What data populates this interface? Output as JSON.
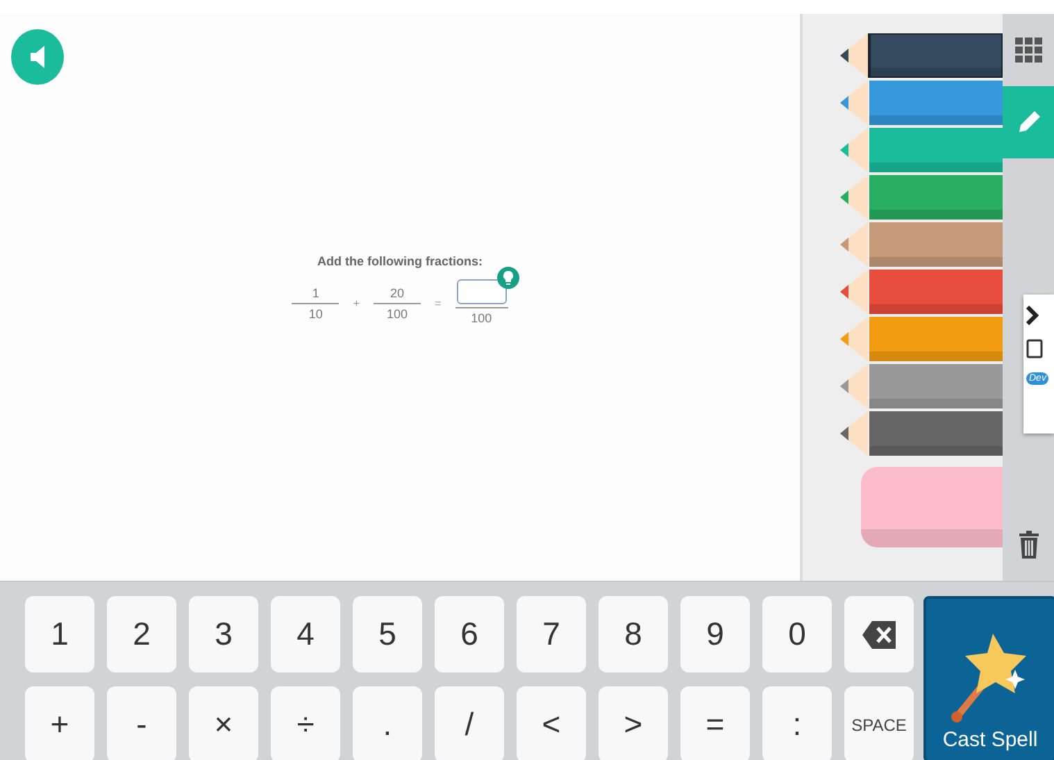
{
  "question": {
    "prompt": "Add the following fractions:",
    "equation": [
      {
        "kind": "fraction",
        "numerator": "1",
        "denominator": "10"
      },
      {
        "kind": "operator",
        "text": "+"
      },
      {
        "kind": "fraction",
        "numerator": "20",
        "denominator": "100"
      },
      {
        "kind": "operator",
        "text": "="
      },
      {
        "kind": "answer",
        "denominator": "100"
      }
    ]
  },
  "pencils": [
    {
      "color": "#34495e",
      "selected": true
    },
    {
      "color": "#3498db",
      "selected": false
    },
    {
      "color": "#1abc9c",
      "selected": false
    },
    {
      "color": "#27ae60",
      "selected": false
    },
    {
      "color": "#c49a78",
      "selected": false
    },
    {
      "color": "#e74c3c",
      "selected": false
    },
    {
      "color": "#f39c12",
      "selected": false
    },
    {
      "color": "#999999",
      "selected": false
    },
    {
      "color": "#666666",
      "selected": false
    }
  ],
  "tools": [
    {
      "kind": "grid",
      "selected": false
    },
    {
      "kind": "pencil",
      "selected": true
    },
    {
      "kind": "trash",
      "selected": false
    }
  ],
  "popup": [
    {
      "kind": "chevron"
    },
    {
      "kind": "tablet"
    },
    {
      "kind": "badge",
      "text": "Dev"
    }
  ],
  "keys": [
    {
      "kind": "char",
      "label": "1"
    },
    {
      "kind": "char",
      "label": "2"
    },
    {
      "kind": "char",
      "label": "3"
    },
    {
      "kind": "char",
      "label": "4"
    },
    {
      "kind": "char",
      "label": "5"
    },
    {
      "kind": "char",
      "label": "6"
    },
    {
      "kind": "char",
      "label": "7"
    },
    {
      "kind": "char",
      "label": "8"
    },
    {
      "kind": "char",
      "label": "9"
    },
    {
      "kind": "char",
      "label": "0"
    },
    {
      "kind": "backspace"
    },
    {
      "kind": "char",
      "label": "+"
    },
    {
      "kind": "char",
      "label": "-"
    },
    {
      "kind": "char",
      "label": "×"
    },
    {
      "kind": "char",
      "label": "÷"
    },
    {
      "kind": "char",
      "label": "."
    },
    {
      "kind": "char",
      "label": "/"
    },
    {
      "kind": "char",
      "label": "<"
    },
    {
      "kind": "char",
      "label": ">"
    },
    {
      "kind": "char",
      "label": "="
    },
    {
      "kind": "char",
      "label": ":"
    },
    {
      "kind": "space",
      "label": "SPACE"
    }
  ],
  "cast_spell": {
    "label": "Cast Spell"
  }
}
